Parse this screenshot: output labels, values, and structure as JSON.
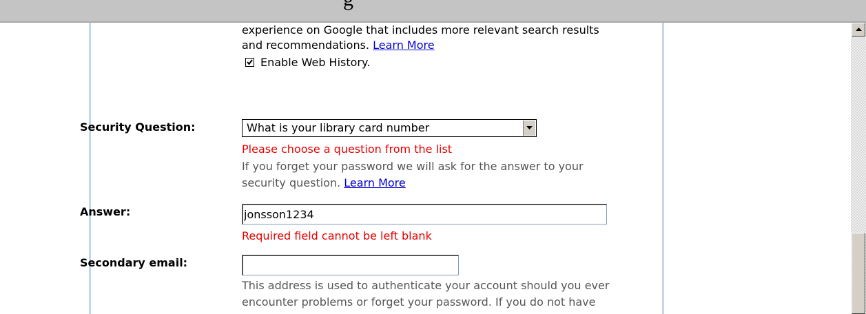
{
  "window": {
    "title_fragment": "g"
  },
  "web_history": {
    "text_line1": "experience on Google that includes more relevant search results",
    "text_line2": "and recommendations.",
    "learn_more": "Learn More",
    "checkbox_label": "Enable Web History.",
    "checkbox_checked": true
  },
  "security_question": {
    "label": "Security Question:",
    "selected": "What is your library card number",
    "error": "Please choose a question from the list",
    "hint_line1": "If you forget your password we will ask for the answer to your",
    "hint_line2": "security question.",
    "learn_more": "Learn More"
  },
  "answer": {
    "label": "Answer:",
    "value": "jonsson1234",
    "error": "Required field cannot be left blank"
  },
  "secondary_email": {
    "label": "Secondary email:",
    "value": "",
    "hint_line1": "This address is used to authenticate your account should you ever",
    "hint_line2": "encounter problems or forget your password. If you do not have"
  },
  "colors": {
    "error": "#e60000",
    "link": "#0000cc",
    "panel_border": "#c5d7ef",
    "topbar": "#c4c4c4"
  },
  "icons": {
    "checkbox_mark": "check-icon",
    "select_arrow": "chevron-down-icon",
    "scroll_up": "arrow-up-icon"
  }
}
